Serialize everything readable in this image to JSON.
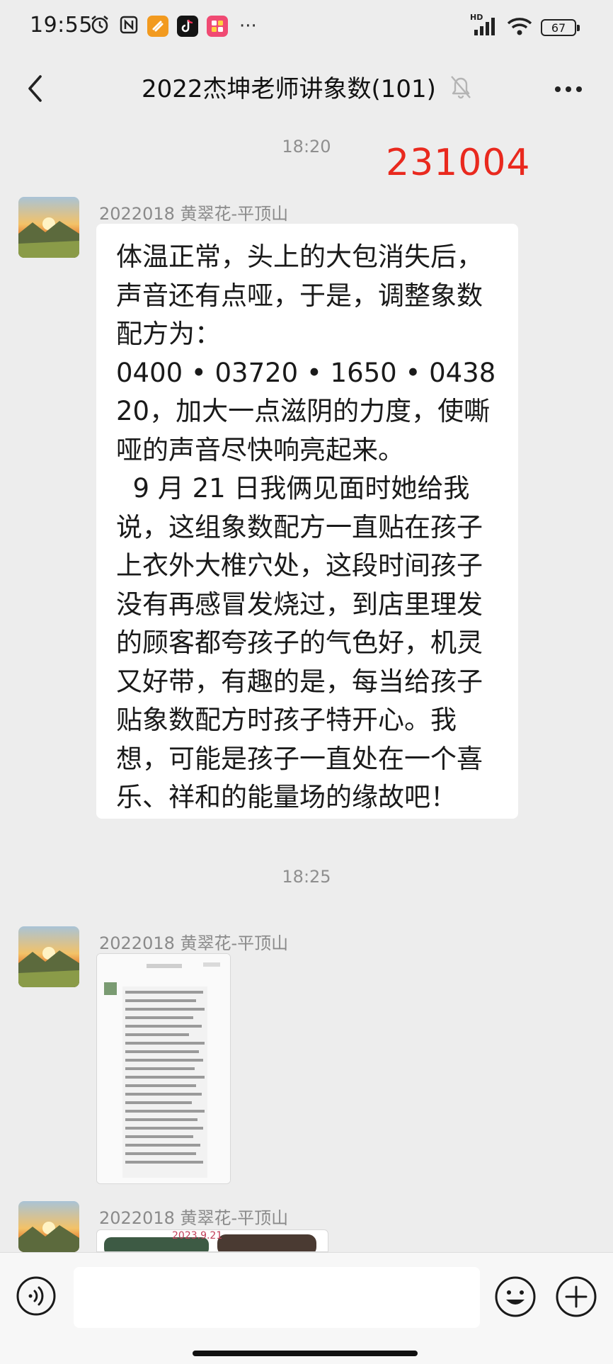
{
  "status_bar": {
    "time": "19:55",
    "network": "HD",
    "battery": "67",
    "more": "···",
    "icons": [
      "alarm-icon",
      "nfc-icon",
      "app-orange-icon",
      "tiktok-icon",
      "app-pink-icon",
      "signal-icon",
      "wifi-icon",
      "battery-icon"
    ]
  },
  "nav": {
    "title": "2022杰坤老师讲象数(101)",
    "back_icon": "chevron-left-icon",
    "mute_icon": "bell-muted-icon",
    "menu_icon": "more-dots-icon"
  },
  "messages": {
    "time_1": "18:20",
    "overlay_number": "231004",
    "message_1": {
      "sender": "2022018 黄翠花-平顶山",
      "text": "体温正常，头上的大包消失后，声音还有点哑，于是，调整象数配方为：\n0400 • 03720 • 1650 • 043820，加大一点滋阴的力度，使嘶哑的声音尽快响亮起来。\n  9 月 21 日我俩见面时她给我说，这组象数配方一直贴在孩子上衣外大椎穴处，这段时间孩子没有再感冒发烧过，到店里理发的顾客都夸孩子的气色好，机灵又好带，有趣的是，每当给孩子贴象数配方时孩子特开心。我想，可能是孩子一直处在一个喜乐、祥和的能量场的缘故吧！"
    },
    "time_2": "18:25",
    "message_2": {
      "sender": "2022018 黄翠花-平顶山"
    },
    "message_3": {
      "sender": "2022018 黄翠花-平顶山",
      "image_date": "2023.9.21"
    }
  },
  "input_bar": {
    "voice_icon": "voice-icon",
    "emoji_icon": "emoji-icon",
    "plus_icon": "plus-icon"
  },
  "colors": {
    "background": "#ededed",
    "bubble": "#ffffff",
    "stamp_red": "#e9291e",
    "muted_text": "#8a8a8a"
  }
}
